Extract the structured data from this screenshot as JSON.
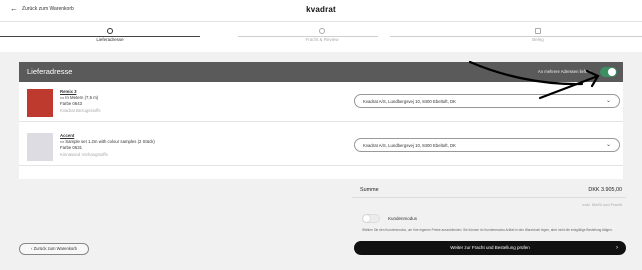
{
  "header": {
    "back_label": "Zurück zum Warenkorb",
    "logo": "kvadrat"
  },
  "steps": [
    {
      "label": "Lieferadresse",
      "active": true
    },
    {
      "label": "Fracht & Review",
      "active": false
    },
    {
      "label": "Beleg",
      "active": false
    }
  ],
  "panel": {
    "title": "Lieferadresse",
    "toggle_label": "An mehrere Adressen liefern",
    "toggle_on": true
  },
  "items": [
    {
      "name": "Remix 3",
      "qty": "In Metern (7,5 m)",
      "color": "Farbe 0643",
      "category": "Kvadrat Bezugsstoffe",
      "swatch": "#bf3a2e",
      "address": "Kvadrat A/S, Lundbergsvej 10, 8400 Ebeltoft, DK"
    },
    {
      "name": "Accent",
      "qty": "Sample set 1.2m with colour samples (2 Stück)",
      "color": "Farbe 0631",
      "category": "Kinnasand Vorhangstoffe",
      "swatch": "#dcdce2",
      "address": "Kvadrat A/S, Lundbergsvej 10, 8400 Ebeltoft, DK"
    }
  ],
  "summary": {
    "label": "Summe",
    "value": "DKK 3.905,00",
    "note": "exkl. MwSt und Fracht",
    "customer_mode_label": "Kundenmodus",
    "customer_mode_desc": "Wählen Sie den Kundenmodus, um Ihre eigenen Preise auszublenden. Sie können im Kundenmodus Artikel in den Warenkorb legen, aber nicht die endgültige Bestellung tätigen.",
    "cta_label": "Weiter zur Fracht und Bestellung prüfen"
  },
  "footer": {
    "back_label": "Zurück zum Warenkorb"
  }
}
